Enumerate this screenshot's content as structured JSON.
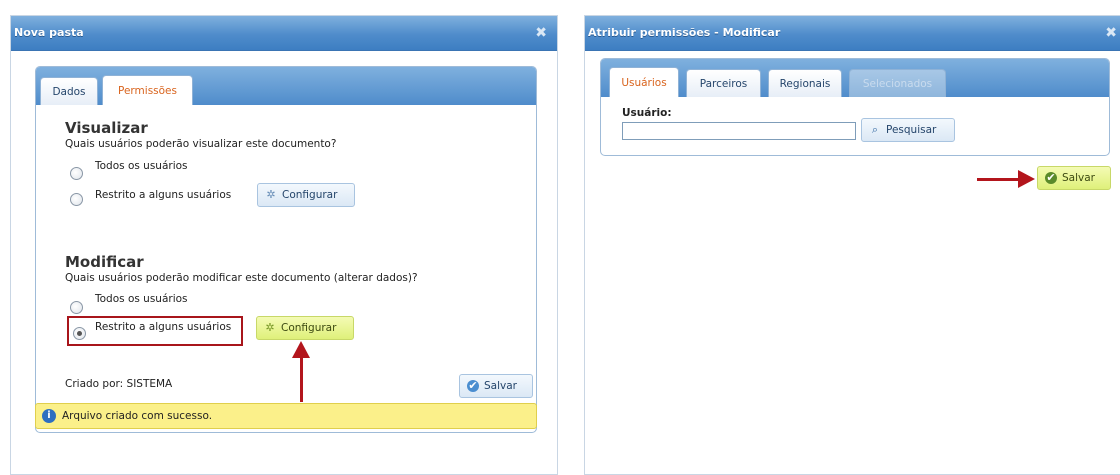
{
  "left_dialog": {
    "title": "Nova pasta",
    "tabs": [
      "Dados",
      "Permissões"
    ],
    "active_tab": "Permissões",
    "visualizar": {
      "heading": "Visualizar",
      "question": "Quais usuários poderão visualizar este documento?",
      "options": [
        "Todos os usuários",
        "Restrito a alguns usuários"
      ],
      "selected": "Todos os usuários",
      "configure_label": "Configurar"
    },
    "modificar": {
      "heading": "Modificar",
      "question": "Quais usuários poderão modificar este documento (alterar dados)?",
      "options": [
        "Todos os usuários",
        "Restrito a alguns usuários"
      ],
      "selected": "Restrito a alguns usuários",
      "configure_label": "Configurar"
    },
    "created_by": "Criado por: SISTEMA",
    "save_label": "Salvar",
    "message": "Arquivo criado com sucesso."
  },
  "right_dialog": {
    "title": "Atribuir permissões - Modificar",
    "tabs": [
      "Usuários",
      "Parceiros",
      "Regionais",
      "Selecionados"
    ],
    "active_tab": "Usuários",
    "disabled_tab": "Selecionados",
    "user_label": "Usuário:",
    "user_value": "",
    "search_label": "Pesquisar",
    "save_label": "Salvar"
  },
  "colors": {
    "title_bar": "#4f8ccb",
    "active_tab_text": "#d9641e",
    "highlight_button": "#dff07a",
    "annotation_red": "#b3151c",
    "message_bg": "#fbf08a"
  },
  "icons": {
    "close": "close-icon",
    "configure": "gear-icon",
    "save": "check-circle-icon",
    "search": "search-icon",
    "info": "info-icon"
  }
}
